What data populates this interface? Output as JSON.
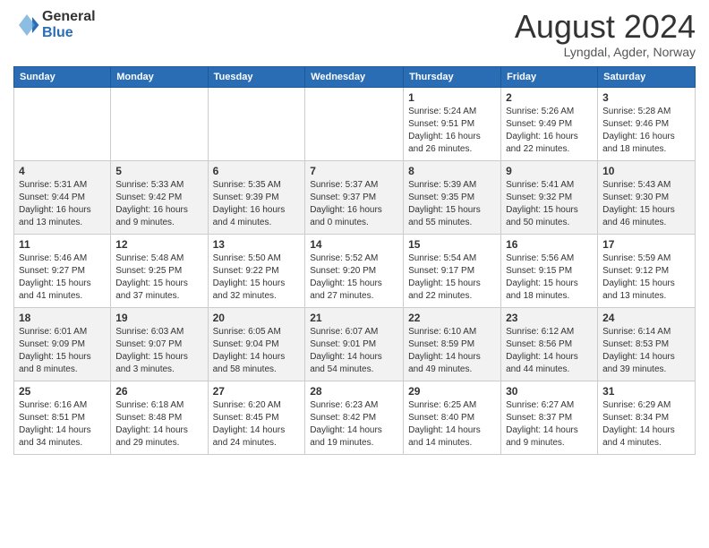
{
  "logo": {
    "general": "General",
    "blue": "Blue"
  },
  "title": "August 2024",
  "subtitle": "Lyngdal, Agder, Norway",
  "headers": [
    "Sunday",
    "Monday",
    "Tuesday",
    "Wednesday",
    "Thursday",
    "Friday",
    "Saturday"
  ],
  "weeks": [
    [
      {
        "day": "",
        "info": ""
      },
      {
        "day": "",
        "info": ""
      },
      {
        "day": "",
        "info": ""
      },
      {
        "day": "",
        "info": ""
      },
      {
        "day": "1",
        "info": "Sunrise: 5:24 AM\nSunset: 9:51 PM\nDaylight: 16 hours\nand 26 minutes."
      },
      {
        "day": "2",
        "info": "Sunrise: 5:26 AM\nSunset: 9:49 PM\nDaylight: 16 hours\nand 22 minutes."
      },
      {
        "day": "3",
        "info": "Sunrise: 5:28 AM\nSunset: 9:46 PM\nDaylight: 16 hours\nand 18 minutes."
      }
    ],
    [
      {
        "day": "4",
        "info": "Sunrise: 5:31 AM\nSunset: 9:44 PM\nDaylight: 16 hours\nand 13 minutes."
      },
      {
        "day": "5",
        "info": "Sunrise: 5:33 AM\nSunset: 9:42 PM\nDaylight: 16 hours\nand 9 minutes."
      },
      {
        "day": "6",
        "info": "Sunrise: 5:35 AM\nSunset: 9:39 PM\nDaylight: 16 hours\nand 4 minutes."
      },
      {
        "day": "7",
        "info": "Sunrise: 5:37 AM\nSunset: 9:37 PM\nDaylight: 16 hours\nand 0 minutes."
      },
      {
        "day": "8",
        "info": "Sunrise: 5:39 AM\nSunset: 9:35 PM\nDaylight: 15 hours\nand 55 minutes."
      },
      {
        "day": "9",
        "info": "Sunrise: 5:41 AM\nSunset: 9:32 PM\nDaylight: 15 hours\nand 50 minutes."
      },
      {
        "day": "10",
        "info": "Sunrise: 5:43 AM\nSunset: 9:30 PM\nDaylight: 15 hours\nand 46 minutes."
      }
    ],
    [
      {
        "day": "11",
        "info": "Sunrise: 5:46 AM\nSunset: 9:27 PM\nDaylight: 15 hours\nand 41 minutes."
      },
      {
        "day": "12",
        "info": "Sunrise: 5:48 AM\nSunset: 9:25 PM\nDaylight: 15 hours\nand 37 minutes."
      },
      {
        "day": "13",
        "info": "Sunrise: 5:50 AM\nSunset: 9:22 PM\nDaylight: 15 hours\nand 32 minutes."
      },
      {
        "day": "14",
        "info": "Sunrise: 5:52 AM\nSunset: 9:20 PM\nDaylight: 15 hours\nand 27 minutes."
      },
      {
        "day": "15",
        "info": "Sunrise: 5:54 AM\nSunset: 9:17 PM\nDaylight: 15 hours\nand 22 minutes."
      },
      {
        "day": "16",
        "info": "Sunrise: 5:56 AM\nSunset: 9:15 PM\nDaylight: 15 hours\nand 18 minutes."
      },
      {
        "day": "17",
        "info": "Sunrise: 5:59 AM\nSunset: 9:12 PM\nDaylight: 15 hours\nand 13 minutes."
      }
    ],
    [
      {
        "day": "18",
        "info": "Sunrise: 6:01 AM\nSunset: 9:09 PM\nDaylight: 15 hours\nand 8 minutes."
      },
      {
        "day": "19",
        "info": "Sunrise: 6:03 AM\nSunset: 9:07 PM\nDaylight: 15 hours\nand 3 minutes."
      },
      {
        "day": "20",
        "info": "Sunrise: 6:05 AM\nSunset: 9:04 PM\nDaylight: 14 hours\nand 58 minutes."
      },
      {
        "day": "21",
        "info": "Sunrise: 6:07 AM\nSunset: 9:01 PM\nDaylight: 14 hours\nand 54 minutes."
      },
      {
        "day": "22",
        "info": "Sunrise: 6:10 AM\nSunset: 8:59 PM\nDaylight: 14 hours\nand 49 minutes."
      },
      {
        "day": "23",
        "info": "Sunrise: 6:12 AM\nSunset: 8:56 PM\nDaylight: 14 hours\nand 44 minutes."
      },
      {
        "day": "24",
        "info": "Sunrise: 6:14 AM\nSunset: 8:53 PM\nDaylight: 14 hours\nand 39 minutes."
      }
    ],
    [
      {
        "day": "25",
        "info": "Sunrise: 6:16 AM\nSunset: 8:51 PM\nDaylight: 14 hours\nand 34 minutes."
      },
      {
        "day": "26",
        "info": "Sunrise: 6:18 AM\nSunset: 8:48 PM\nDaylight: 14 hours\nand 29 minutes."
      },
      {
        "day": "27",
        "info": "Sunrise: 6:20 AM\nSunset: 8:45 PM\nDaylight: 14 hours\nand 24 minutes."
      },
      {
        "day": "28",
        "info": "Sunrise: 6:23 AM\nSunset: 8:42 PM\nDaylight: 14 hours\nand 19 minutes."
      },
      {
        "day": "29",
        "info": "Sunrise: 6:25 AM\nSunset: 8:40 PM\nDaylight: 14 hours\nand 14 minutes."
      },
      {
        "day": "30",
        "info": "Sunrise: 6:27 AM\nSunset: 8:37 PM\nDaylight: 14 hours\nand 9 minutes."
      },
      {
        "day": "31",
        "info": "Sunrise: 6:29 AM\nSunset: 8:34 PM\nDaylight: 14 hours\nand 4 minutes."
      }
    ]
  ]
}
